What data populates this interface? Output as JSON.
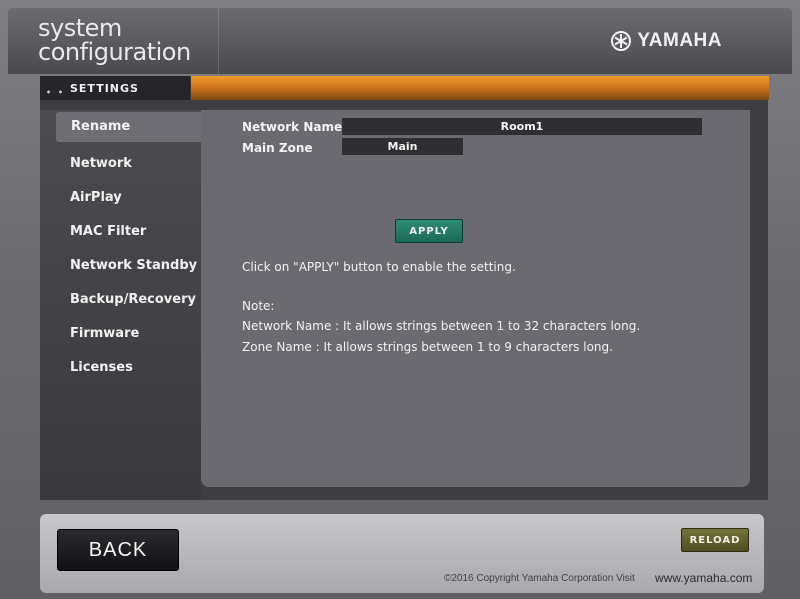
{
  "header": {
    "title_line1": "system",
    "title_line2": "configuration",
    "brand": "YAMAHA"
  },
  "settings": {
    "tab_label": "SETTINGS",
    "dots": "• •"
  },
  "sidebar": {
    "items": [
      {
        "label": "Rename",
        "active": true
      },
      {
        "label": "Network"
      },
      {
        "label": "AirPlay"
      },
      {
        "label": "MAC Filter"
      },
      {
        "label": "Network Standby"
      },
      {
        "label": "Backup/Recovery"
      },
      {
        "label": "Firmware"
      },
      {
        "label": "Licenses"
      }
    ]
  },
  "form": {
    "network_name_label": "Network Name",
    "network_name_value": "Room1",
    "main_zone_label": "Main Zone",
    "main_zone_value": "Main",
    "apply_label": "APPLY"
  },
  "help": {
    "instruction": "Click on \"APPLY\" button to enable the setting.",
    "note_title": "Note:",
    "note_network": "Network Name : It allows strings between 1 to 32 characters long.",
    "note_zone": "Zone Name : It allows strings between 1 to 9 characters long."
  },
  "footer": {
    "back_label": "BACK",
    "reload_label": "RELOAD",
    "copyright": "©2016 Copyright Yamaha Corporation Visit",
    "site": "www.yamaha.com"
  },
  "colors": {
    "accent_orange": "#e48a22",
    "apply_green": "#2e8c76",
    "reload_olive": "#75743a"
  }
}
